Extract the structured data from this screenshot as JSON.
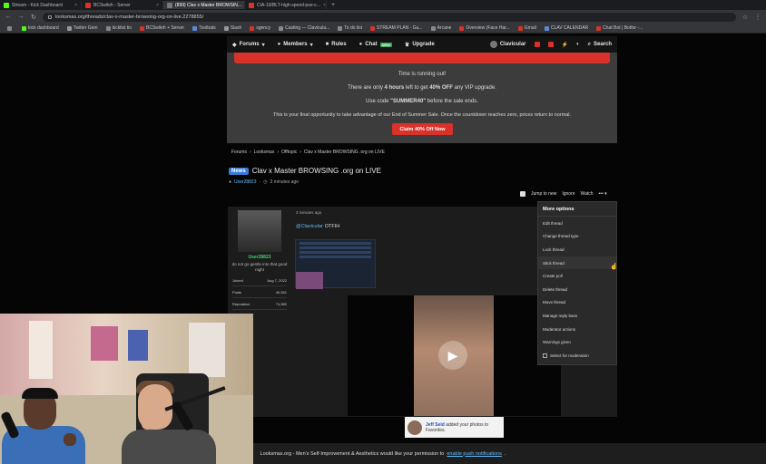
{
  "browser": {
    "tabs": [
      {
        "label": "Stream - Kick Dashboard",
        "color": "#53fc18",
        "active": false
      },
      {
        "label": "BCSwileh - Server",
        "color": "#d8322b",
        "active": false
      },
      {
        "label": "(899) Clav x Master BROWSIN...",
        "color": "#777777",
        "active": true
      },
      {
        "label": "CIA-19/BLT-high-speed-pse-c...",
        "color": "#d8322b",
        "active": false
      }
    ],
    "url": "looksmax.org/threads/clav-x-master-browsing-org-on-live.2278855/",
    "bookmarks": [
      {
        "label": "",
        "color": "#888888"
      },
      {
        "label": "kick dashboard",
        "color": "#53fc18"
      },
      {
        "label": "Twitter Gem",
        "color": "#999999"
      },
      {
        "label": "kicklist tio",
        "color": "#888888"
      },
      {
        "label": "BCSwileh + Server",
        "color": "#d8322b"
      },
      {
        "label": "Toolbats",
        "color": "#5a8ad8"
      },
      {
        "label": "Slash",
        "color": "#999999"
      },
      {
        "label": "sgency",
        "color": "#d8322b"
      },
      {
        "label": "Casting — Clavicula...",
        "color": "#888888"
      },
      {
        "label": "To do list",
        "color": "#888888"
      },
      {
        "label": "STREAM PLAN - Gu...",
        "color": "#d8322b"
      },
      {
        "label": "Arcane",
        "color": "#888888"
      },
      {
        "label": "Overview (Face Har...",
        "color": "#d8322b"
      },
      {
        "label": "Gmail",
        "color": "#d8322b"
      },
      {
        "label": "CLAV CALENDAR",
        "color": "#5a8ad8"
      },
      {
        "label": "Chat Bot | Botfor -...",
        "color": "#d8322b"
      }
    ]
  },
  "site_nav": {
    "items": [
      {
        "label": "Forums",
        "icon": "chat-bubbles-icon"
      },
      {
        "label": "Members",
        "icon": "users-icon"
      },
      {
        "label": "Rules",
        "icon": "book-icon"
      },
      {
        "label": "Chat",
        "icon": "chat-icon",
        "badge": "NEW"
      },
      {
        "label": "Upgrade",
        "icon": "crown-icon"
      }
    ],
    "username": "Clavicular",
    "search": "Search"
  },
  "promo": {
    "line1": "Time is running out!",
    "line2_pre": "There are only ",
    "line2_hours": "4 hours",
    "line2_mid": " left to get ",
    "line2_off": "40% OFF",
    "line2_post": " any VIP upgrade.",
    "line3_pre": "Use code ",
    "line3_code": "\"SUMMER40\"",
    "line3_post": " before the sale ends.",
    "line4": "This is your final opportunity to take advantage of our End of Summer Sale. Once the countdown reaches zero, prices return to normal.",
    "button": "Claim 40% Off Now"
  },
  "breadcrumb": [
    "Forums",
    "Looksmax",
    "Offtopic",
    "Clav x Master BROWSING .org on LIVE"
  ],
  "thread": {
    "prefix": "News",
    "title": "Clav x Master BROWSING .org on LIVE",
    "author": "User28823",
    "time": "3 minutes ago"
  },
  "thread_actions": {
    "jump": "Jump to new",
    "ignore": "Ignore",
    "watch": "Watch",
    "more": "•••"
  },
  "post": {
    "time": "3 minutes ago",
    "mention": "@Clavicular",
    "text": "OTFIH",
    "username": "User28823",
    "user_title": "do not go gentle into that good night",
    "stats": [
      {
        "label": "Joined",
        "value": "Aug 7, 2022"
      },
      {
        "label": "Posts",
        "value": "40,551"
      },
      {
        "label": "Reputation",
        "value": "74,980"
      }
    ]
  },
  "photo_note": {
    "name": "Jeff Seid",
    "text": "added your photos to Favorites."
  },
  "dropdown": {
    "header": "More options",
    "items": [
      "Edit thread",
      "Change thread type",
      "Lock thread",
      "Stick thread",
      "Create poll",
      "Delete thread",
      "Move thread",
      "Manage reply bans",
      "Moderator actions",
      "Warnings given"
    ],
    "select": "Select for moderation"
  },
  "cookie_bar": {
    "text": "Looksmax.org - Men's Self-Improvement & Aesthetics would like your permission to",
    "link": "enable push notifications",
    "end": "."
  }
}
